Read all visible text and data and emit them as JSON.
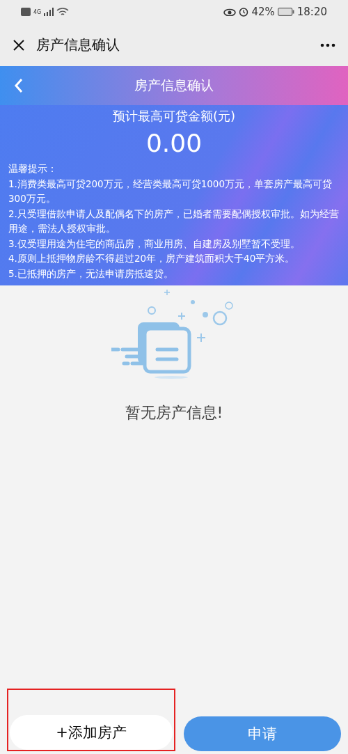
{
  "status_bar": {
    "network": "4G",
    "battery": "42%",
    "time": "18:20"
  },
  "nav_bar": {
    "title": "房产信息确认"
  },
  "header": {
    "title": "房产信息确认"
  },
  "loan": {
    "label": "预计最高可贷金额(元)",
    "amount": "0.00"
  },
  "tips": {
    "title": "温馨提示：",
    "items": [
      "1.消费类最高可贷200万元，经营类最高可贷1000万元，单套房产最高可贷300万元。",
      "2.只受理借款申请人及配偶名下的房产，已婚者需要配偶授权审批。如为经营用途，需法人授权审批。",
      "3.仅受理用途为住宅的商品房，商业用房、自建房及别墅暂不受理。",
      "4.原则上抵押物房龄不得超过20年，房产建筑面积大于40平方米。",
      "5.已抵押的房产，无法申请房抵速贷。"
    ]
  },
  "empty_state": {
    "message": "暂无房产信息!"
  },
  "buttons": [
    {
      "kind": "secondary",
      "label": "+添加房产",
      "highlighted": true
    },
    {
      "kind": "primary",
      "label": "申请",
      "highlighted": false
    }
  ]
}
